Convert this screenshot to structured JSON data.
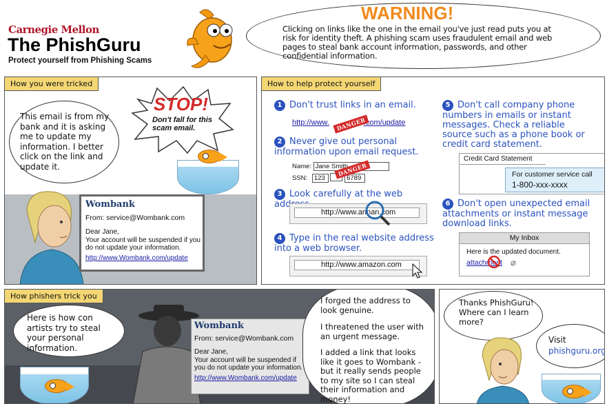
{
  "header": {
    "university": "Carnegie Mellon",
    "title": "The PhishGuru",
    "subtitle": "Protect yourself from Phishing Scams"
  },
  "warning": {
    "title": "WARNING!",
    "text": "Clicking on links like the one in the email you've just read puts you at risk for identity theft. A phishing scam uses fraudulent email and web pages to steal bank account information, passwords, and other confidential information."
  },
  "panel_tricked": {
    "tag": "How you were tricked",
    "thought": "This email is from my bank and it is asking me to update my information. I better click on the link and update it.",
    "stop_title": "STOP!",
    "stop_text": "Don't fall for this scam email."
  },
  "email": {
    "bank": "Wombank",
    "from": "From: service@Wombank.com",
    "greeting": "Dear Jane,",
    "body": "Your account will be suspended if you do not update your information.",
    "link": "http://www.Wombank.com/update"
  },
  "panel_protect": {
    "tag": "How to help protect yourself",
    "tips": [
      {
        "num": "1",
        "text": "Don't trust links in an email."
      },
      {
        "num": "2",
        "text": "Never give out personal information upon email request."
      },
      {
        "num": "3",
        "text": "Look carefully at the web address."
      },
      {
        "num": "4",
        "text": "Type in the real website address into a web browser."
      },
      {
        "num": "5",
        "text": "Don't call company phone numbers in emails or instant messages. Check a reliable source such as a phone book or credit card statement."
      },
      {
        "num": "6",
        "text": "Don't open unexpected email attachments or instant message download links."
      }
    ],
    "tip1_link": "http://www.",
    "tip1_link_end": ".com/update",
    "danger": "DANGER",
    "name_label": "Name:",
    "name_value": "Jane Smith",
    "ssn_label": "SSN:",
    "ssn_a": "123",
    "ssn_c": "6789",
    "url3_a": "http://www.",
    "url3_b": "annan.com",
    "url4": "http://www.amazon.com",
    "cc_title": "Credit Card Statement",
    "cc_line1": "For customer service call",
    "cc_line2": "1-800-xxx-xxxx",
    "inbox_title": "My Inbox",
    "inbox_text": "Here is the updated document.",
    "inbox_link": "attachment"
  },
  "panel_phishers": {
    "tag": "How phishers trick you",
    "bubble": "Here is how con artists try to steal your personal information.",
    "confession": [
      "I forged the address to look genuine.",
      "I threatened the user with an urgent message.",
      "I added a link that looks like it goes to Wombank - but it really sends people to my site so I can steal their information and money!"
    ]
  },
  "panel_learn": {
    "question": "Thanks PhishGuru! Where can I learn more?",
    "visit": "Visit",
    "site": "phishguru.org"
  },
  "colors": {
    "tag": "#f4d774",
    "blue": "#2a52be",
    "danger": "#d42a2a",
    "warning": "#f08a1c"
  }
}
